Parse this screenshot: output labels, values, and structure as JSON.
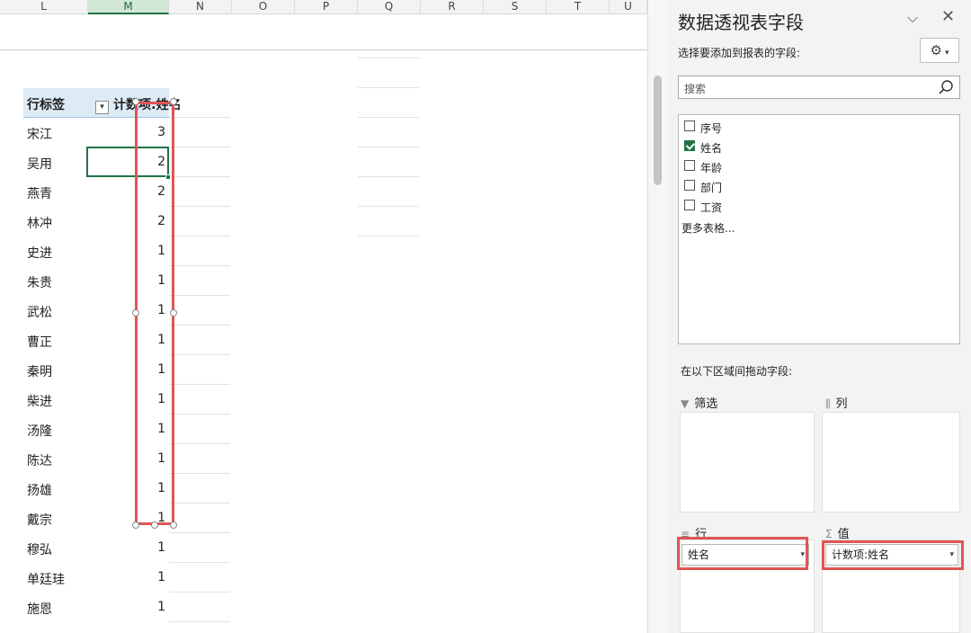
{
  "sheet": {
    "columns": [
      "L",
      "M",
      "N",
      "O",
      "P",
      "Q",
      "R",
      "S",
      "T",
      "U"
    ],
    "active_column": "M",
    "pivot": {
      "row_label_header": "行标签",
      "value_header": "计数项:姓名",
      "rows": [
        {
          "name": "宋江",
          "count": "3"
        },
        {
          "name": "吴用",
          "count": "2"
        },
        {
          "name": "燕青",
          "count": "2"
        },
        {
          "name": "林冲",
          "count": "2"
        },
        {
          "name": "史进",
          "count": "1"
        },
        {
          "name": "朱贵",
          "count": "1"
        },
        {
          "name": "武松",
          "count": "1"
        },
        {
          "name": "曹正",
          "count": "1"
        },
        {
          "name": "秦明",
          "count": "1"
        },
        {
          "name": "柴进",
          "count": "1"
        },
        {
          "name": "汤隆",
          "count": "1"
        },
        {
          "name": "陈达",
          "count": "1"
        },
        {
          "name": "扬雄",
          "count": "1"
        },
        {
          "name": "戴宗",
          "count": "1"
        },
        {
          "name": "穆弘",
          "count": "1"
        },
        {
          "name": "单廷珪",
          "count": "1"
        },
        {
          "name": "施恩",
          "count": "1"
        }
      ]
    }
  },
  "panel": {
    "title": "数据透视表字段",
    "choose_label": "选择要添加到报表的字段:",
    "search_placeholder": "搜索",
    "fields": [
      {
        "name": "序号",
        "checked": false
      },
      {
        "name": "姓名",
        "checked": true
      },
      {
        "name": "年龄",
        "checked": false
      },
      {
        "name": "部门",
        "checked": false
      },
      {
        "name": "工资",
        "checked": false
      }
    ],
    "more_tables": "更多表格...",
    "drag_label": "在以下区域间拖动字段:",
    "zones": {
      "filter": "筛选",
      "columns": "列",
      "rows": "行",
      "values": "值"
    },
    "rows_field": "姓名",
    "values_field": "计数项:姓名"
  },
  "colors": {
    "excel_green": "#217346",
    "highlight_red": "#e05555",
    "pivot_header_bg": "#ddebf7"
  }
}
